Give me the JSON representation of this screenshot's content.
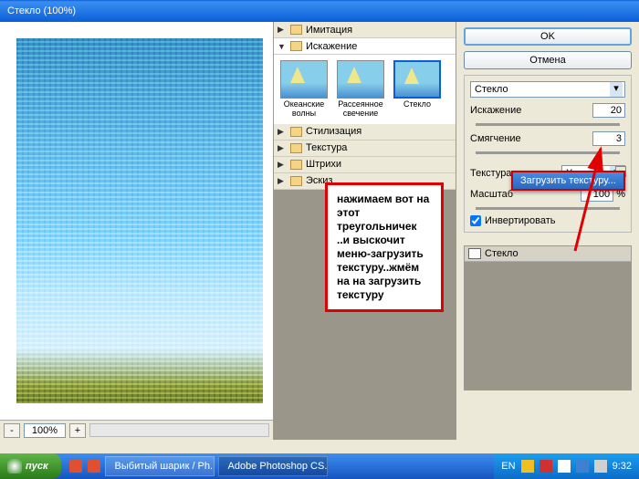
{
  "title": "Стекло (100%)",
  "zoom": {
    "minus": "-",
    "value": "100%",
    "plus": "+"
  },
  "categories": {
    "cat0": "Имитация",
    "cat1": "Искажение",
    "cat2": "Стилизация",
    "cat3": "Текстура",
    "cat4": "Штрихи",
    "cat5": "Эскиз"
  },
  "thumbs": {
    "t0": "Океанские волны",
    "t1": "Рассеянное свечение",
    "t2": "Стекло"
  },
  "buttons": {
    "ok": "OK",
    "cancel": "Отмена"
  },
  "filter": {
    "name": "Стекло",
    "distort_label": "Искажение",
    "distort_value": "20",
    "smooth_label": "Смягчение",
    "smooth_value": "3",
    "texture_label": "Текстура:",
    "texture_value": "Холст",
    "scale_label": "Масштаб",
    "scale_value": "100",
    "scale_suffix": "%",
    "invert_label": "Инвертировать"
  },
  "menu": {
    "load_texture": "Загрузить текстуру..."
  },
  "layer": {
    "name": "Стекло"
  },
  "annotation": "нажимаем вот на этот треугольничек ..и выскочит меню-загрузить текстуру..жмём на на загрузить текстуру",
  "taskbar": {
    "start": "пуск",
    "items": {
      "i0": "Выбитый шарик / Ph...",
      "i1": "Adobe Photoshop CS..."
    },
    "lang": "EN",
    "time": "9:32"
  }
}
